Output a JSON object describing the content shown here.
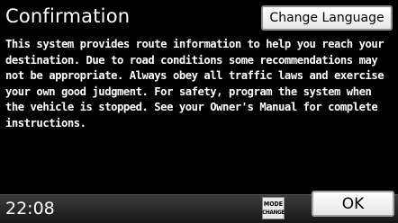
{
  "dialog": {
    "title": "Confirmation",
    "change_language_label": "Change Language",
    "message_lines": [
      "This system provides route information to help you reach your",
      "destination. Due to road conditions some recommendations may",
      "not be appropriate. Always obey all traffic laws and exercise",
      "your own good judgment. For safety, program the system when",
      "the vehicle is stopped. See your Owner's Manual for complete",
      "instructions."
    ],
    "ok_label": "OK"
  },
  "status_bar": {
    "time": "22:08",
    "mode_change_top": "MODE",
    "mode_change_bottom": "CHANGE"
  }
}
